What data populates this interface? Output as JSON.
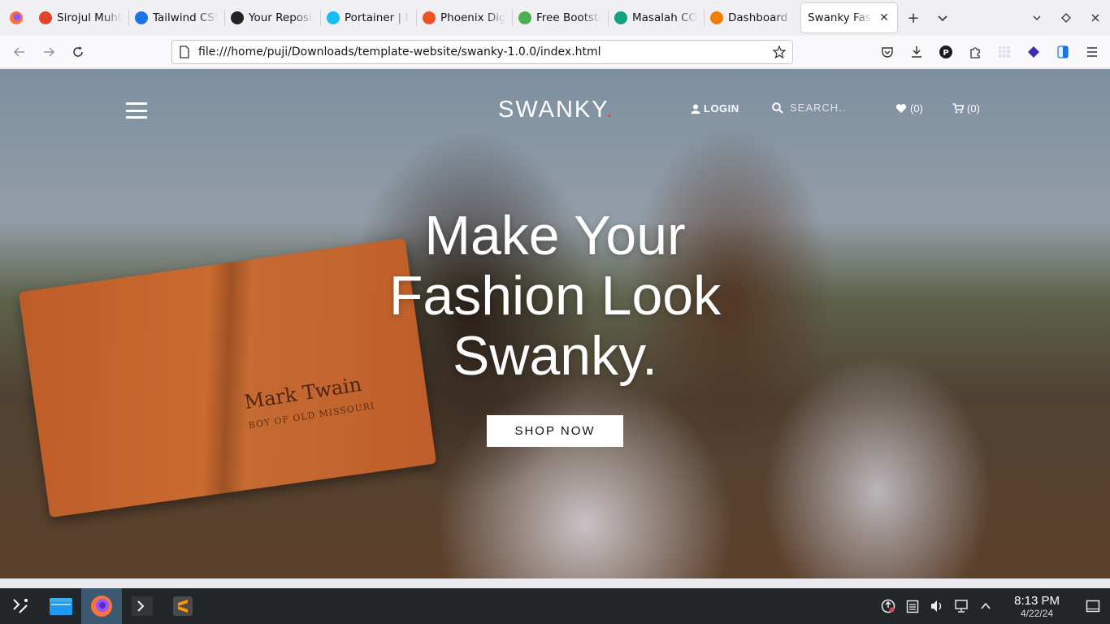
{
  "browser": {
    "tabs": [
      {
        "label": "Sirojul Muhta",
        "icon": "gitlab-icon",
        "color": "#e24329"
      },
      {
        "label": "Tailwind CSS",
        "icon": "play-icon",
        "color": "#1a73e8"
      },
      {
        "label": "Your Reposit",
        "icon": "github-icon",
        "color": "#222222"
      },
      {
        "label": "Portainer | lo",
        "icon": "portainer-icon",
        "color": "#13bef9"
      },
      {
        "label": "Phoenix Digi",
        "icon": "phoenix-icon",
        "color": "#f25022"
      },
      {
        "label": "Free Bootstra",
        "icon": "leaf-icon",
        "color": "#4caf50"
      },
      {
        "label": "Masalah COR",
        "icon": "openai-icon",
        "color": "#10a37f"
      },
      {
        "label": "Dashboard |",
        "icon": "dashboard-icon",
        "color": "#f57c00"
      },
      {
        "label": "Swanky Fashio",
        "icon": "",
        "color": "",
        "active": true
      }
    ],
    "url": "file:///home/puji/Downloads/template-website/swanky-1.0.0/index.html"
  },
  "site": {
    "brand": "SWANKY",
    "brand_dot": ".",
    "login": "LOGIN",
    "search_placeholder": "SEARCH..",
    "wishlist_count": "(0)",
    "cart_count": "(0)",
    "hero_line1": "Make Your",
    "hero_line2": "Fashion Look",
    "hero_line3": "Swanky.",
    "cta": "SHOP NOW",
    "book_title": "Mark Twain",
    "book_subtitle": "BOY OF OLD MISSOURI",
    "accent_color": "#e8434a"
  },
  "taskbar": {
    "time": "8:13 PM",
    "date": "4/22/24"
  }
}
